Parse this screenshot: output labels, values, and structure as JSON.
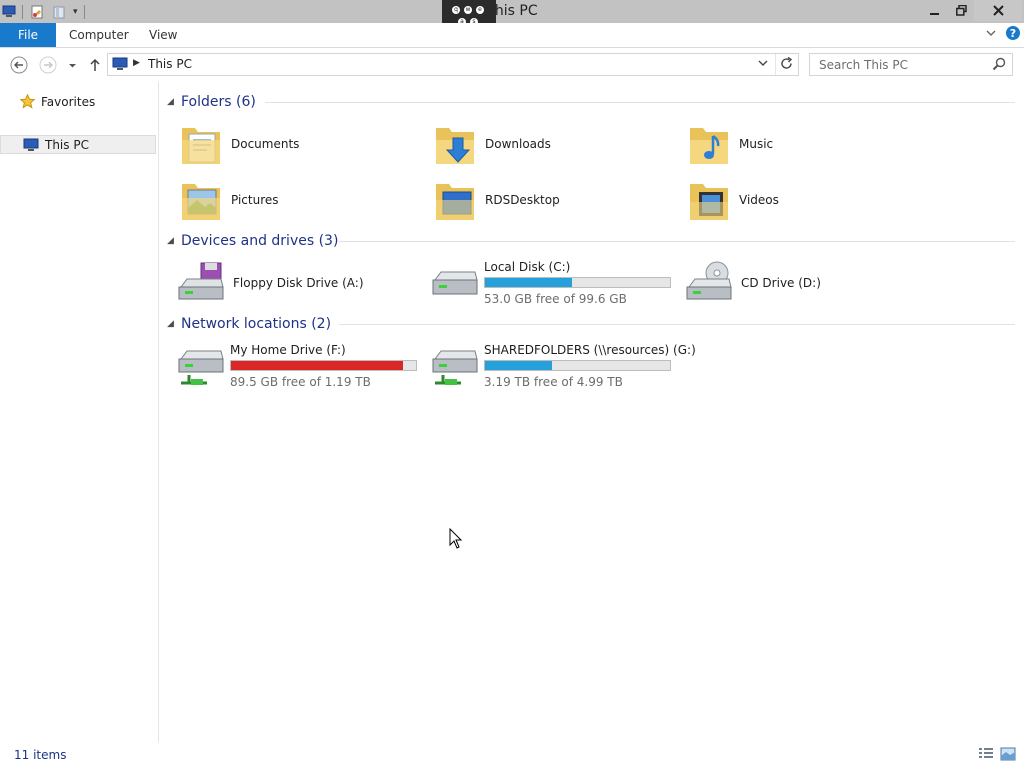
{
  "window": {
    "title": "This PC"
  },
  "qat": {
    "overflow_glyph": "▾"
  },
  "ribbon": {
    "tabs": [
      {
        "id": "file",
        "label": "File"
      },
      {
        "id": "computer",
        "label": "Computer"
      },
      {
        "id": "view",
        "label": "View"
      }
    ],
    "help_glyph": "?",
    "accent": "#1979ca"
  },
  "addressbar": {
    "breadcrumb": "This PC",
    "search_placeholder": "Search This PC"
  },
  "navpane": {
    "favorites": "Favorites",
    "this_pc": "This PC"
  },
  "groups": {
    "folders": {
      "title": "Folders (6)",
      "items": [
        {
          "label": "Documents",
          "icon": "documents-folder-icon"
        },
        {
          "label": "Downloads",
          "icon": "downloads-folder-icon"
        },
        {
          "label": "Music",
          "icon": "music-folder-icon"
        },
        {
          "label": "Pictures",
          "icon": "pictures-folder-icon"
        },
        {
          "label": "RDSDesktop",
          "icon": "desktop-folder-icon"
        },
        {
          "label": "Videos",
          "icon": "videos-folder-icon"
        }
      ]
    },
    "devices": {
      "title": "Devices and drives (3)",
      "items": [
        {
          "label": "Floppy Disk Drive (A:)",
          "icon": "floppy-drive-icon"
        },
        {
          "label": "Local Disk (C:)",
          "icon": "hard-disk-icon",
          "free_text": "53.0 GB free of 99.6 GB",
          "used_fraction": 0.47,
          "bar_color": "#26a0da"
        },
        {
          "label": "CD Drive (D:)",
          "icon": "cd-drive-icon"
        }
      ]
    },
    "network": {
      "title": "Network locations (2)",
      "items": [
        {
          "label": "My Home Drive (F:)",
          "icon": "network-drive-icon",
          "free_text": "89.5 GB free of 1.19 TB",
          "used_fraction": 0.93,
          "bar_color": "#da2626"
        },
        {
          "label": "SHAREDFOLDERS (\\\\resources) (G:)",
          "icon": "network-drive-icon",
          "free_text": "3.19 TB free of 4.99 TB",
          "used_fraction": 0.36,
          "bar_color": "#26a0da"
        }
      ]
    }
  },
  "status": {
    "item_count": "11 items"
  }
}
